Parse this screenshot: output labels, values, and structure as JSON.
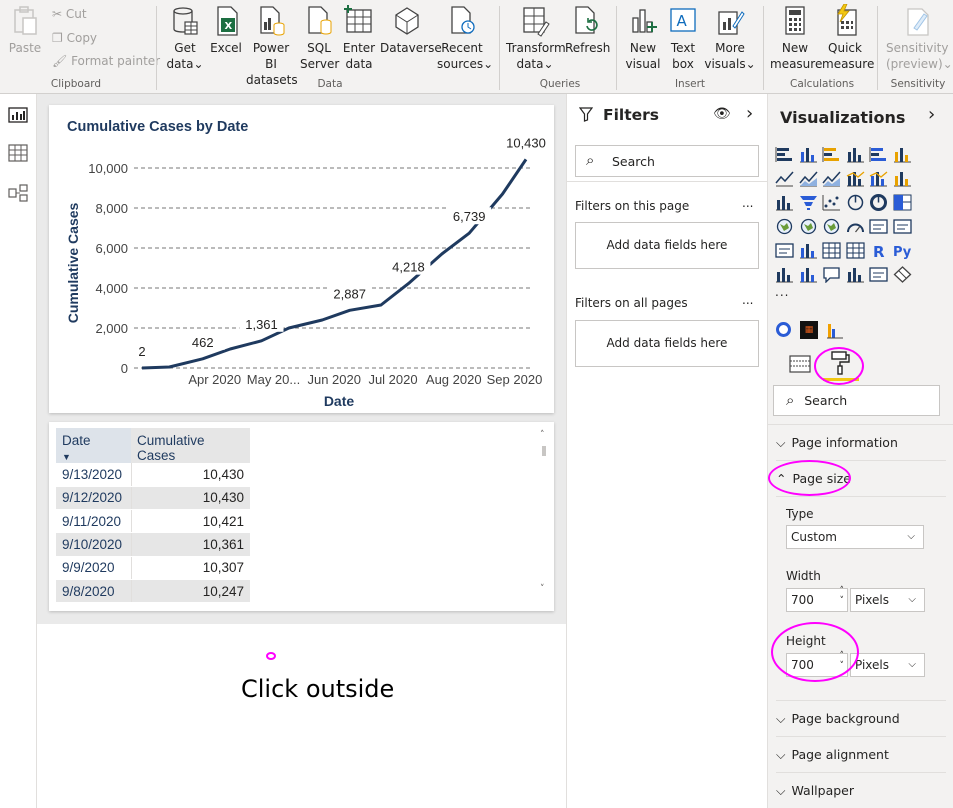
{
  "ribbon": {
    "clipboard": {
      "paste": "Paste",
      "cut": "Cut",
      "copy": "Copy",
      "format_painter": "Format painter",
      "group": "Clipboard"
    },
    "data": {
      "get_data": "Get",
      "get_data2": "data",
      "excel": "Excel",
      "powerbi": "Power BI",
      "powerbi2": "datasets",
      "sql": "SQL",
      "sql2": "Server",
      "enter": "Enter",
      "enter2": "data",
      "dataverse": "Dataverse",
      "recent": "Recent",
      "recent2": "sources",
      "group": "Data"
    },
    "queries": {
      "transform": "Transform",
      "transform2": "data",
      "refresh": "Refresh",
      "group": "Queries"
    },
    "insert": {
      "new_visual": "New",
      "new_visual2": "visual",
      "textbox": "Text",
      "textbox2": "box",
      "more": "More",
      "more2": "visuals",
      "group": "Insert"
    },
    "calculations": {
      "new_measure": "New",
      "new_measure2": "measure",
      "quick": "Quick",
      "quick2": "measure",
      "group": "Calculations"
    },
    "sensitivity": {
      "label": "Sensitivity",
      "label2": "(preview)",
      "group": "Sensitivity"
    }
  },
  "chart_data": {
    "type": "line",
    "title": "Cumulative Cases by Date",
    "xlabel": "Date",
    "ylabel": "Cumulative Cases",
    "ylim": [
      0,
      10500
    ],
    "yticks": [
      "0",
      "2,000",
      "4,000",
      "6,000",
      "8,000",
      "10,000"
    ],
    "xticks": [
      "Apr 2020",
      "May 20...",
      "Jun 2020",
      "Jul 2020",
      "Aug 2020",
      "Sep 2020"
    ],
    "x": [
      "2020-03-01",
      "2020-03-15",
      "2020-04-01",
      "2020-04-15",
      "2020-05-01",
      "2020-05-15",
      "2020-06-01",
      "2020-06-15",
      "2020-07-01",
      "2020-07-15",
      "2020-08-01",
      "2020-08-15",
      "2020-09-01",
      "2020-09-13"
    ],
    "y": [
      2,
      50,
      462,
      950,
      1361,
      2000,
      2400,
      2887,
      3150,
      4218,
      5700,
      6739,
      8700,
      10430
    ],
    "data_labels": [
      "2",
      "462",
      "1,361",
      "2,887",
      "4,218",
      "6,739",
      "10,430"
    ],
    "color": "#1f3a5f"
  },
  "table": {
    "headers": [
      "Date",
      "Cumulative Cases"
    ],
    "rows": [
      [
        "9/13/2020",
        "10,430"
      ],
      [
        "9/12/2020",
        "10,430"
      ],
      [
        "9/11/2020",
        "10,421"
      ],
      [
        "9/10/2020",
        "10,361"
      ],
      [
        "9/9/2020",
        "10,307"
      ],
      [
        "9/8/2020",
        "10,247"
      ]
    ]
  },
  "annotation": "Click outside",
  "filters": {
    "title": "Filters",
    "search": "Search",
    "on_page": "Filters on this page",
    "add1": "Add data fields here",
    "on_all": "Filters on all pages",
    "add2": "Add data fields here",
    "dots": "..."
  },
  "viz": {
    "title": "Visualizations",
    "search": "Search",
    "more": "...",
    "sections": {
      "page_info": "Page information",
      "page_size": "Page size",
      "page_bg": "Page background",
      "page_align": "Page alignment",
      "wallpaper": "Wallpaper"
    },
    "type_label": "Type",
    "type_value": "Custom",
    "width_label": "Width",
    "width_value": "700",
    "width_unit": "Pixels",
    "height_label": "Height",
    "height_value": "700",
    "height_unit": "Pixels",
    "r_icon": "R",
    "py_icon": "Py"
  },
  "colors": {
    "accent": "#f2c811",
    "annotation": "#ff00ff",
    "navy": "#1f3a5f"
  }
}
